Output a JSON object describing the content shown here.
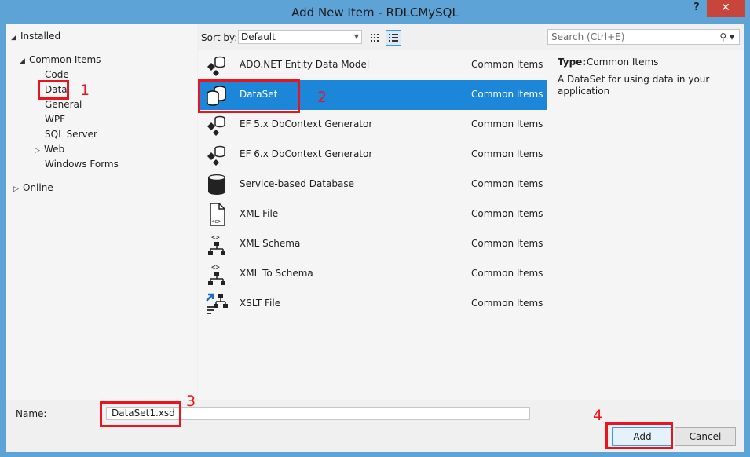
{
  "window": {
    "title": "Add New Item - RDLCMySQL",
    "help": "?",
    "close": "✕"
  },
  "tree": {
    "installed": "Installed",
    "common_items": "Common Items",
    "children": [
      "Code",
      "Data",
      "General",
      "WPF",
      "SQL Server",
      "Web",
      "Windows Forms"
    ],
    "online": "Online"
  },
  "toolbar": {
    "sort_label": "Sort by:",
    "sort_value": "Default",
    "search_placeholder": "Search (Ctrl+E)"
  },
  "items": [
    {
      "name": "ADO.NET Entity Data Model",
      "category": "Common Items",
      "icon": "entity-model-icon"
    },
    {
      "name": "DataSet",
      "category": "Common Items",
      "icon": "dataset-icon"
    },
    {
      "name": "EF 5.x DbContext Generator",
      "category": "Common Items",
      "icon": "ef-generator-icon"
    },
    {
      "name": "EF 6.x DbContext Generator",
      "category": "Common Items",
      "icon": "ef-generator-icon"
    },
    {
      "name": "Service-based Database",
      "category": "Common Items",
      "icon": "database-icon"
    },
    {
      "name": "XML File",
      "category": "Common Items",
      "icon": "xml-file-icon"
    },
    {
      "name": "XML Schema",
      "category": "Common Items",
      "icon": "xml-schema-icon"
    },
    {
      "name": "XML To Schema",
      "category": "Common Items",
      "icon": "xml-schema-icon"
    },
    {
      "name": "XSLT File",
      "category": "Common Items",
      "icon": "xslt-file-icon"
    }
  ],
  "details": {
    "type_label": "Type:",
    "type_value": "Common Items",
    "description": "A DataSet for using data in your application"
  },
  "bottom": {
    "name_label": "Name:",
    "name_value": "DataSet1.xsd",
    "add_label": "Add",
    "cancel_label": "Cancel"
  },
  "annotations": [
    "1",
    "2",
    "3",
    "4"
  ],
  "colors": {
    "accent": "#1c86d9",
    "annotation": "#e8151e",
    "close": "#c7453a"
  }
}
